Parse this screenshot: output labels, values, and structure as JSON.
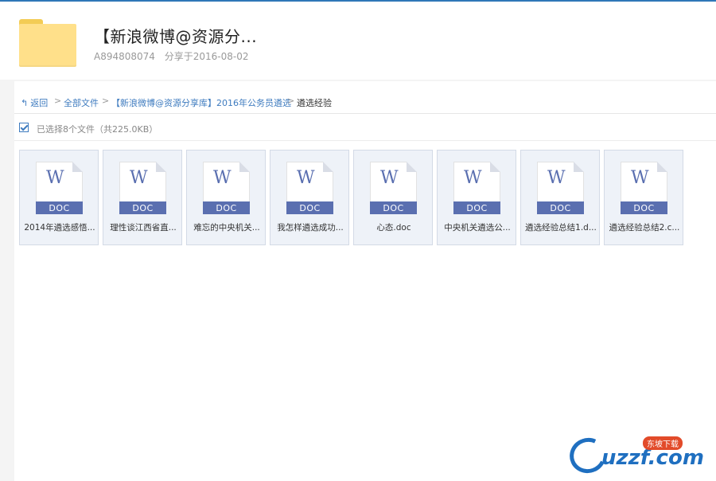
{
  "header": {
    "title": "【新浪微博@资源分...",
    "user": "A894808074",
    "shared": "分享于2016-08-02"
  },
  "breadcrumb": {
    "back": "返回",
    "items": [
      "全部文件",
      "【新浪微博@资源分享库】2016年公务员遴选",
      "遴选经验"
    ],
    "separator": ">"
  },
  "selection": {
    "info": "已选择8个文件（共225.0KB）"
  },
  "files": [
    {
      "name": "2014年遴选感悟...",
      "ext": "DOC"
    },
    {
      "name": "理性谈江西省直...",
      "ext": "DOC"
    },
    {
      "name": "难忘的中央机关...",
      "ext": "DOC"
    },
    {
      "name": "我怎样遴选成功...",
      "ext": "DOC"
    },
    {
      "name": "心态.doc",
      "ext": "DOC"
    },
    {
      "name": "中央机关遴选公...",
      "ext": "DOC"
    },
    {
      "name": "遴选经验总结1.d...",
      "ext": "DOC"
    },
    {
      "name": "遴选经验总结2.c...",
      "ext": "DOC"
    }
  ],
  "icons": {
    "doc": "word-doc-icon",
    "back": "back-arrow-icon"
  },
  "watermark": {
    "text": "uzzf.com",
    "badge": "东坡下载"
  },
  "colors": {
    "accent": "#3e7bbf",
    "doc_blue": "#5a6fb0",
    "folder": "#ffe08a"
  }
}
